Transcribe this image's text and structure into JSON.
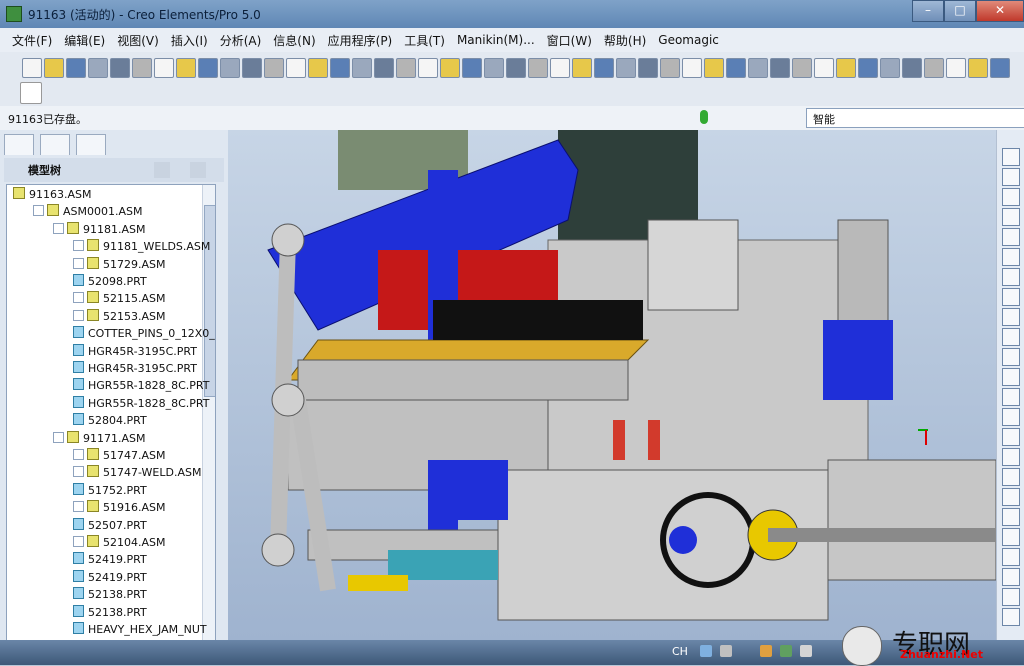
{
  "window": {
    "title": "91163 (活动的) - Creo Elements/Pro 5.0"
  },
  "menu": [
    "文件(F)",
    "编辑(E)",
    "视图(V)",
    "插入(I)",
    "分析(A)",
    "信息(N)",
    "应用程序(P)",
    "工具(T)",
    "Manikin(M)...",
    "窗口(W)",
    "帮助(H)",
    "Geomagic"
  ],
  "status": {
    "message": "91163已存盘。",
    "filter_value": "智能"
  },
  "model_tree": {
    "title": "模型树",
    "items": [
      {
        "label": "91163.ASM",
        "level": 0,
        "type": "asm",
        "expand": false
      },
      {
        "label": "ASM0001.ASM",
        "level": 1,
        "type": "asm",
        "expand": true
      },
      {
        "label": "91181.ASM",
        "level": 2,
        "type": "asm",
        "expand": true
      },
      {
        "label": "91181_WELDS.ASM",
        "level": 3,
        "type": "asm",
        "expand": true
      },
      {
        "label": "51729.ASM",
        "level": 3,
        "type": "asm",
        "expand": true
      },
      {
        "label": "52098.PRT",
        "level": 3,
        "type": "prt",
        "expand": false
      },
      {
        "label": "52115.ASM",
        "level": 3,
        "type": "asm",
        "expand": true
      },
      {
        "label": "52153.ASM",
        "level": 3,
        "type": "asm",
        "expand": true
      },
      {
        "label": "COTTER_PINS_0_12X0_",
        "level": 3,
        "type": "prt",
        "expand": false
      },
      {
        "label": "HGR45R-3195C.PRT",
        "level": 3,
        "type": "prt",
        "expand": false
      },
      {
        "label": "HGR45R-3195C.PRT",
        "level": 3,
        "type": "prt",
        "expand": false
      },
      {
        "label": "HGR55R-1828_8C.PRT",
        "level": 3,
        "type": "prt",
        "expand": false
      },
      {
        "label": "HGR55R-1828_8C.PRT",
        "level": 3,
        "type": "prt",
        "expand": false
      },
      {
        "label": "52804.PRT",
        "level": 3,
        "type": "prt",
        "expand": false
      },
      {
        "label": "91171.ASM",
        "level": 2,
        "type": "asm",
        "expand": true
      },
      {
        "label": "51747.ASM",
        "level": 3,
        "type": "asm",
        "expand": true
      },
      {
        "label": "51747-WELD.ASM",
        "level": 3,
        "type": "asm",
        "expand": true
      },
      {
        "label": "51752.PRT",
        "level": 3,
        "type": "prt",
        "expand": false
      },
      {
        "label": "51916.ASM",
        "level": 3,
        "type": "asm",
        "expand": true
      },
      {
        "label": "52507.PRT",
        "level": 3,
        "type": "prt",
        "expand": false
      },
      {
        "label": "52104.ASM",
        "level": 3,
        "type": "asm",
        "expand": true
      },
      {
        "label": "52419.PRT",
        "level": 3,
        "type": "prt",
        "expand": false
      },
      {
        "label": "52419.PRT",
        "level": 3,
        "type": "prt",
        "expand": false
      },
      {
        "label": "52138.PRT",
        "level": 3,
        "type": "prt",
        "expand": false
      },
      {
        "label": "52138.PRT",
        "level": 3,
        "type": "prt",
        "expand": false
      },
      {
        "label": "HEAVY_HEX_JAM_NUT",
        "level": 3,
        "type": "prt",
        "expand": false
      }
    ]
  },
  "taskbar": {
    "ime": "CH",
    "watermark": "专职网",
    "watermark_url": "Zhuanzhi.Net"
  },
  "colors": {
    "frame_blue": "#1f2fd8",
    "red_part": "#d01818",
    "yellow_plate": "#d9a92b"
  }
}
